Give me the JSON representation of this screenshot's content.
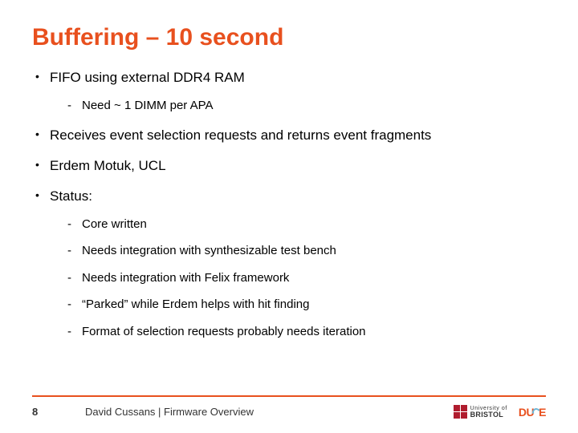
{
  "title": "Buffering – 10 second",
  "bullets": [
    {
      "text": "FIFO using external DDR4 RAM",
      "sub": [
        "Need ~ 1 DIMM per APA"
      ]
    },
    {
      "text": "Receives event selection requests and returns event fragments"
    },
    {
      "text": "Erdem Motuk, UCL"
    },
    {
      "text": "Status:",
      "sub": [
        "Core written",
        "Needs integration with synthesizable test bench",
        "Needs integration with Felix framework",
        "“Parked” while Erdem helps with hit finding",
        "Format of selection requests probably needs iteration"
      ]
    }
  ],
  "footer": {
    "page": "8",
    "text": "David Cussans | Firmware Overview",
    "bristol_line1": "University of",
    "bristol_line2": "BRISTOL",
    "dune_prefix": "DU",
    "dune_suffix": "E"
  }
}
